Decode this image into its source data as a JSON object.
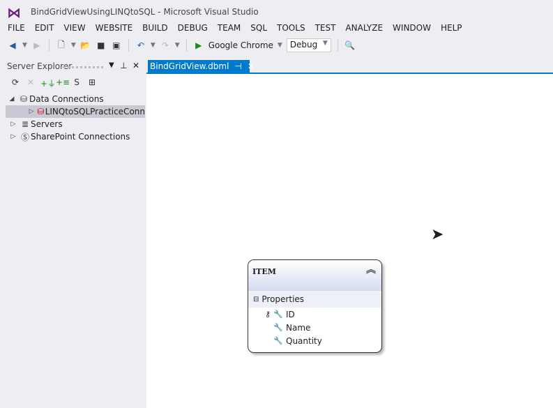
{
  "window": {
    "title": "BindGridViewUsingLINQtoSQL - Microsoft Visual Studio"
  },
  "menu": [
    "FILE",
    "EDIT",
    "VIEW",
    "WEBSITE",
    "BUILD",
    "DEBUG",
    "TEAM",
    "SQL",
    "TOOLS",
    "TEST",
    "ANALYZE",
    "WINDOW",
    "HELP"
  ],
  "toolbar": {
    "run_target": "Google Chrome",
    "configuration": "Debug"
  },
  "server_explorer": {
    "title": "Server Explorer",
    "tree": [
      {
        "label": "Data Connections",
        "expanded": true
      },
      {
        "label": "LINQtoSQLPracticeConn",
        "selected": true
      },
      {
        "label": "Servers"
      },
      {
        "label": "SharePoint Connections"
      }
    ]
  },
  "tab": {
    "label": "BindGridView.dbml"
  },
  "entity": {
    "name": "ITEM",
    "section": "Properties",
    "properties": [
      "ID",
      "Name",
      "Quantity"
    ]
  }
}
